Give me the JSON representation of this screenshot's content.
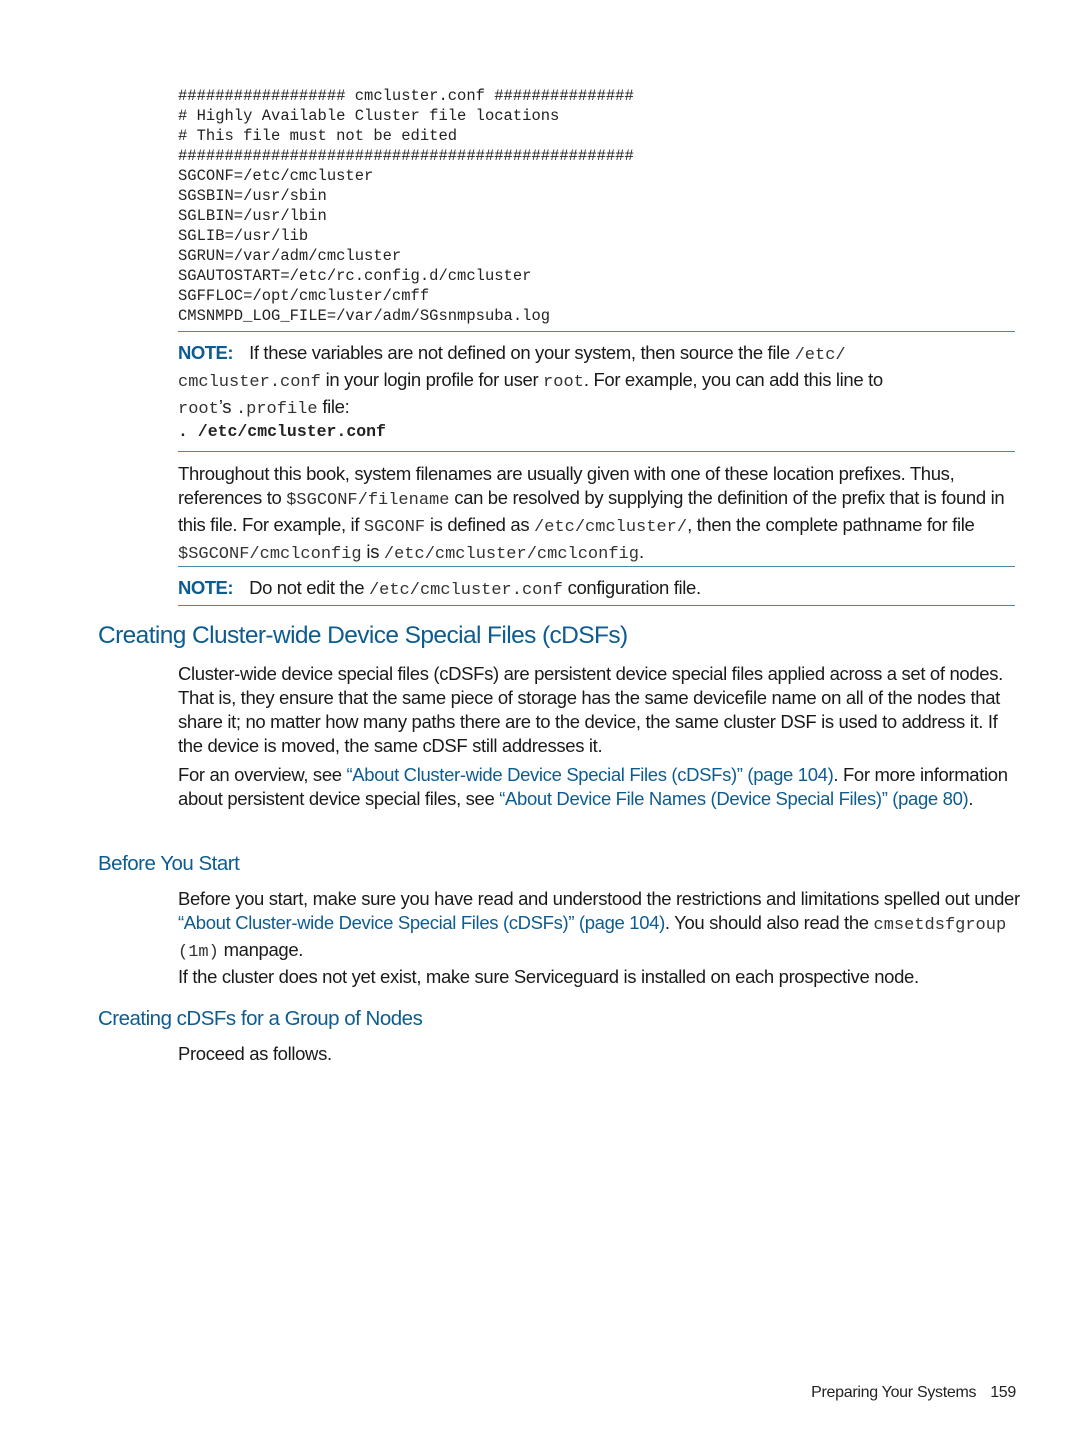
{
  "code_block": {
    "lines": [
      "################## cmcluster.conf ###############",
      "# Highly Available Cluster file locations",
      "# This file must not be edited",
      "#################################################",
      "SGCONF=/etc/cmcluster",
      "SGSBIN=/usr/sbin",
      "SGLBIN=/usr/lbin",
      "SGLIB=/usr/lib",
      "SGRUN=/var/adm/cmcluster",
      "SGAUTOSTART=/etc/rc.config.d/cmcluster",
      "SGFFLOC=/opt/cmcluster/cmff",
      "CMSNMPD_LOG_FILE=/var/adm/SGsnmpsuba.log"
    ]
  },
  "note1": {
    "label": "NOTE:",
    "t1": "If these variables are not defined on your system, then source the file ",
    "c1": "/etc/",
    "c2": "cmcluster.conf",
    "t2": " in your login profile for user ",
    "c3": "root",
    "t3": ". For example, you can add this line to",
    "c4": "root",
    "t4": "’s ",
    "c5": ".profile",
    "t5": " file:",
    "command": ". /etc/cmcluster.conf"
  },
  "para1": {
    "t1": "Throughout this book, system filenames are usually given with one of these location prefixes. Thus, references to ",
    "c1": "$SGCONF/filename",
    "t2": " can be resolved by supplying the definition of the prefix that is found in this file. For example, if ",
    "c2": "SGCONF",
    "t3": " is defined as ",
    "c3": "/etc/cmcluster/",
    "t4": ", then the complete pathname for file ",
    "c4": "$SGCONF/cmclconfig",
    "t5": " is ",
    "c5": "/etc/cmcluster/cmclconfig",
    "t6": "."
  },
  "note2": {
    "label": "NOTE:",
    "t1": "Do not edit the ",
    "c1": "/etc/cmcluster.conf",
    "t2": " configuration file."
  },
  "section": {
    "heading": "Creating Cluster-wide Device Special Files (cDSFs)",
    "intro": "Cluster-wide device special files (cDSFs) are persistent device special files applied across a set of nodes. That is, they ensure that the same piece of storage has the same devicefile name on all of the nodes that share it; no matter how many paths there are to the device, the same cluster DSF is used to address it. If the device is moved, the same cDSF still addresses it.",
    "overview": {
      "t1": "For an overview, see ",
      "link1": "“About Cluster-wide Device Special Files (cDSFs)” (page 104)",
      "t2": ". For more information about persistent device special files, see ",
      "link2": "“About Device File Names (Device Special Files)” (page 80)",
      "t3": "."
    }
  },
  "before_you_start": {
    "heading": "Before You Start",
    "t1": "Before you start, make sure you have read and understood the restrictions and limitations spelled out under ",
    "link1": "“About Cluster-wide Device Special Files (cDSFs)” (page 104)",
    "t2": ". You should also read the ",
    "c1": "cmsetdsfgroup (1m)",
    "t3": " manpage.",
    "para2": "If the cluster does not yet exist, make sure Serviceguard is installed on each prospective node."
  },
  "group_nodes": {
    "heading": "Creating cDSFs for a Group of Nodes",
    "text": "Proceed as follows."
  },
  "footer": {
    "section": "Preparing Your Systems",
    "page": "159"
  }
}
